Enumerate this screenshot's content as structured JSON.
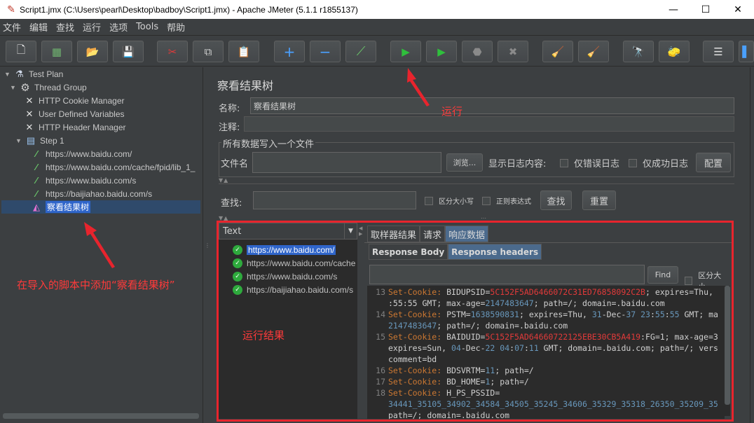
{
  "window": {
    "title": "Script1.jmx (C:\\Users\\pearl\\Desktop\\badboy\\Script1.jmx) - Apache JMeter (5.1.1 r1855137)",
    "minimize": "—",
    "maximize": "☐",
    "close": "✕"
  },
  "menu": [
    "文件",
    "编辑",
    "查找",
    "运行",
    "选项",
    "Tools",
    "帮助"
  ],
  "toolbar": [
    {
      "name": "new-icon",
      "glyph": "🗋"
    },
    {
      "name": "templates-icon",
      "glyph": "▦"
    },
    {
      "name": "open-icon",
      "glyph": "📂"
    },
    {
      "name": "save-icon",
      "glyph": "💾"
    },
    {
      "name": "cut-icon",
      "glyph": "✂"
    },
    {
      "name": "copy-icon",
      "glyph": "⧉"
    },
    {
      "name": "paste-icon",
      "glyph": "📋"
    },
    {
      "name": "expand-icon",
      "glyph": "+"
    },
    {
      "name": "collapse-icon",
      "glyph": "−"
    },
    {
      "name": "toggle-icon",
      "glyph": "⟋"
    },
    {
      "name": "start-icon",
      "glyph": "▶"
    },
    {
      "name": "start-no-pause-icon",
      "glyph": "▶"
    },
    {
      "name": "stop-icon",
      "glyph": "⬣"
    },
    {
      "name": "shutdown-icon",
      "glyph": "✖"
    },
    {
      "name": "clear-icon",
      "glyph": "🧹"
    },
    {
      "name": "clear-all-icon",
      "glyph": "🧹"
    },
    {
      "name": "search-icon",
      "glyph": "🔭"
    },
    {
      "name": "reset-search-icon",
      "glyph": "🧽"
    },
    {
      "name": "function-helper-icon",
      "glyph": "☰"
    },
    {
      "name": "help-icon",
      "glyph": "▌"
    }
  ],
  "tree": [
    {
      "label": "Test Plan",
      "icon": "flask-icon",
      "glyph": "⚗",
      "color": "#cfd8e8"
    },
    {
      "label": "Thread Group",
      "icon": "gear-icon",
      "glyph": "⚙",
      "color": "#cfcfcf"
    },
    {
      "label": "HTTP Cookie Manager",
      "icon": "wrench-icon",
      "glyph": "✕",
      "color": "#e0e0e0"
    },
    {
      "label": "User Defined Variables",
      "icon": "wrench-icon",
      "glyph": "✕",
      "color": "#e0e0e0"
    },
    {
      "label": "HTTP Header Manager",
      "icon": "wrench-icon",
      "glyph": "✕",
      "color": "#e0e0e0"
    },
    {
      "label": "Step 1",
      "icon": "controller-icon",
      "glyph": "▤",
      "color": "#9bc4f0"
    },
    {
      "label": "https://www.baidu.com/",
      "icon": "pipette-icon",
      "glyph": "⁄",
      "color": "#6bc86b"
    },
    {
      "label": "https://www.baidu.com/cache/fpid/lib_1_",
      "icon": "pipette-icon",
      "glyph": "⁄",
      "color": "#6bc86b"
    },
    {
      "label": "https://www.baidu.com/s",
      "icon": "pipette-icon",
      "glyph": "⁄",
      "color": "#6bc86b"
    },
    {
      "label": "https://baijiahao.baidu.com/s",
      "icon": "pipette-icon",
      "glyph": "⁄",
      "color": "#6bc86b"
    },
    {
      "label": "察看结果树",
      "icon": "chart-icon",
      "glyph": "◭",
      "color": "#e070d0"
    }
  ],
  "panel": {
    "title": "察看结果树",
    "name_label": "名称:",
    "name_value": "察看结果树",
    "comment_label": "注释:",
    "fieldset_title": "所有数据写入一个文件",
    "file_label": "文件名",
    "browse": "浏览...",
    "log_label": "显示日志内容:",
    "errors_only": "仅错误日志",
    "success_only": "仅成功日志",
    "configure": "配置",
    "search_label": "查找:",
    "case_sensitive": "区分大小写",
    "regex": "正则表达式",
    "search_btn": "查找",
    "reset_btn": "重置"
  },
  "results": {
    "renderer": "Text",
    "items": [
      "https://www.baidu.com/",
      "https://www.baidu.com/cache",
      "https://www.baidu.com/s",
      "https://baijiahao.baidu.com/s"
    ],
    "tabs": [
      "取样器结果",
      "请求",
      "响应数据"
    ],
    "subtabs": [
      "Response Body",
      "Response headers"
    ],
    "find_btn": "Find",
    "find_case": "区分大小"
  },
  "code": [
    {
      "n": "13",
      "parts": [
        [
          "k",
          "Set-Cookie:"
        ],
        [
          "t",
          " BIDUPSID="
        ],
        [
          "v",
          "5C152F5AD6466072C31ED76858092C2B"
        ],
        [
          "t",
          "; expires=Thu,"
        ]
      ]
    },
    {
      "n": "",
      "parts": [
        [
          "t",
          ":55:55 GMT; max-age="
        ],
        [
          "n",
          "2147483647"
        ],
        [
          "t",
          "; path=/; domain=.baidu.com"
        ]
      ]
    },
    {
      "n": "14",
      "parts": [
        [
          "k",
          "Set-Cookie:"
        ],
        [
          "t",
          " PSTM="
        ],
        [
          "n",
          "1638590831"
        ],
        [
          "t",
          "; expires=Thu, "
        ],
        [
          "n",
          "31"
        ],
        [
          "t",
          "-Dec-"
        ],
        [
          "n",
          "37"
        ],
        [
          "t",
          " "
        ],
        [
          "n",
          "23"
        ],
        [
          "t",
          ":"
        ],
        [
          "n",
          "55"
        ],
        [
          "t",
          ":"
        ],
        [
          "n",
          "55"
        ],
        [
          "t",
          " GMT; ma"
        ]
      ]
    },
    {
      "n": "",
      "parts": [
        [
          "n",
          "2147483647"
        ],
        [
          "t",
          "; path=/; domain=.baidu.com"
        ]
      ]
    },
    {
      "n": "15",
      "parts": [
        [
          "k",
          "Set-Cookie:"
        ],
        [
          "t",
          " BAIDUID="
        ],
        [
          "v",
          "5C152F5AD64660722125EBE30CB5A419"
        ],
        [
          "t",
          ":FG=1; max-age=3"
        ]
      ]
    },
    {
      "n": "",
      "parts": [
        [
          "t",
          "expires=Sun, "
        ],
        [
          "n",
          "04"
        ],
        [
          "t",
          "-Dec-"
        ],
        [
          "n",
          "22"
        ],
        [
          "t",
          " "
        ],
        [
          "n",
          "04"
        ],
        [
          "t",
          ":"
        ],
        [
          "n",
          "07"
        ],
        [
          "t",
          ":"
        ],
        [
          "n",
          "11"
        ],
        [
          "t",
          " GMT; domain=.baidu.com; path=/; vers"
        ]
      ]
    },
    {
      "n": "",
      "parts": [
        [
          "t",
          "comment=bd"
        ]
      ]
    },
    {
      "n": "16",
      "parts": [
        [
          "k",
          "Set-Cookie:"
        ],
        [
          "t",
          " BDSVRTM="
        ],
        [
          "n",
          "11"
        ],
        [
          "t",
          "; path=/"
        ]
      ]
    },
    {
      "n": "17",
      "parts": [
        [
          "k",
          "Set-Cookie:"
        ],
        [
          "t",
          " BD_HOME="
        ],
        [
          "n",
          "1"
        ],
        [
          "t",
          "; path=/"
        ]
      ]
    },
    {
      "n": "18",
      "parts": [
        [
          "k",
          "Set-Cookie:"
        ],
        [
          "t",
          " H_PS_PSSID="
        ]
      ]
    },
    {
      "n": "",
      "parts": [
        [
          "n",
          "34441_35105_34902_34584_34505_35245_34606_35329_35318_26350_35209_35"
        ]
      ]
    },
    {
      "n": "",
      "parts": [
        [
          "t",
          "path=/; domain=.baidu.com"
        ]
      ]
    }
  ],
  "annotations": {
    "run": "运行",
    "add_tree": "在导入的脚本中添加“察看结果树”",
    "run_result": "运行结果"
  }
}
